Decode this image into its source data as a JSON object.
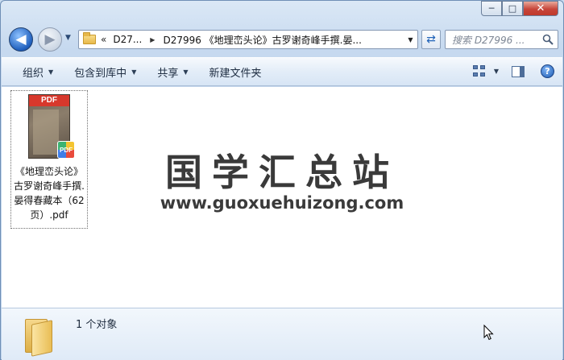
{
  "window": {
    "caption_buttons": {
      "minimize": "─",
      "maximize": "□",
      "close": "✕"
    }
  },
  "navigation": {
    "back_glyph": "◀",
    "forward_glyph": "▶",
    "address": {
      "overflow": "«",
      "crumbs": [
        "D27...",
        "D27996 《地理峦头论》古罗谢奇峰手撰.晏..."
      ]
    },
    "search": {
      "placeholder": "搜索 D27996 ..."
    }
  },
  "toolbar": {
    "organize": "组织",
    "include_in_library": "包含到库中",
    "share": "共享",
    "new_folder": "新建文件夹"
  },
  "content": {
    "file": {
      "thumb_label": "PDF",
      "badge_label": "PDF",
      "name": "《地理峦头论》古罗谢奇峰手撰.晏得春藏本（62页）.pdf"
    },
    "watermark": {
      "title": "国学汇总站",
      "url": "www.guoxuehuizong.com"
    }
  },
  "details": {
    "count_text": "1 个对象"
  },
  "colors": {
    "accent": "#1f5fbd",
    "close": "#c7463a",
    "watermark": "#3a3a3a"
  }
}
